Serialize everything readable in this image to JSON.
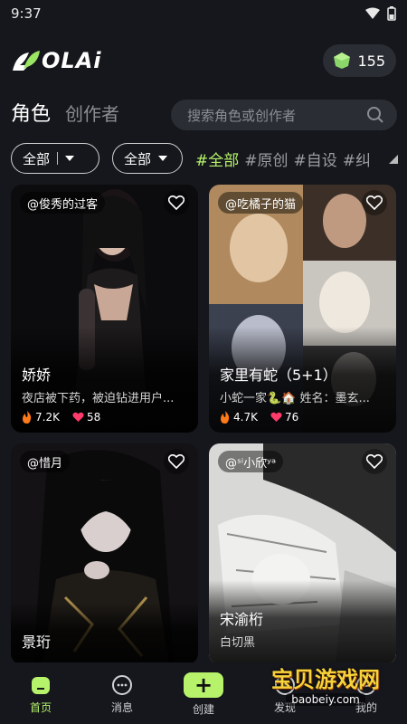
{
  "status_bar": {
    "time": "9:37"
  },
  "header": {
    "logo_text": "OLAi",
    "coins": "155"
  },
  "tabs": {
    "active": "角色",
    "inactive": "创作者"
  },
  "search": {
    "placeholder": "搜索角色或创作者"
  },
  "filters": {
    "dropdown1": "全部",
    "dropdown2": "全部",
    "tags": [
      "#全部",
      "#原创",
      "#自设",
      "#纠"
    ]
  },
  "cards": [
    {
      "author": "@俊秀的过客",
      "title": "娇娇",
      "desc": "夜店被下药，被迫钻进用户...",
      "likes": "7.2K",
      "hearts": "58"
    },
    {
      "author": "@吃橘子的猫",
      "title": "家里有蛇（5+1）",
      "desc": "小蛇一家🐍🏠 姓名：墨玄...",
      "likes": "4.7K",
      "hearts": "76"
    },
    {
      "author": "@惜月",
      "title": "景珩",
      "desc": "",
      "likes": "",
      "hearts": ""
    },
    {
      "author": "@ˢⁱ小欣ʸᵃ",
      "title": "宋渝桁",
      "desc": "白切黑",
      "likes": "",
      "hearts": ""
    }
  ],
  "nav": {
    "home": "首页",
    "messages": "消息",
    "create": "创建",
    "discover": "发现",
    "mine": "我的"
  },
  "watermark": {
    "main": "宝贝游戏网",
    "sub": "baobeiy.com"
  },
  "colors": {
    "accent": "#b6f36b",
    "background": "#15171c"
  }
}
